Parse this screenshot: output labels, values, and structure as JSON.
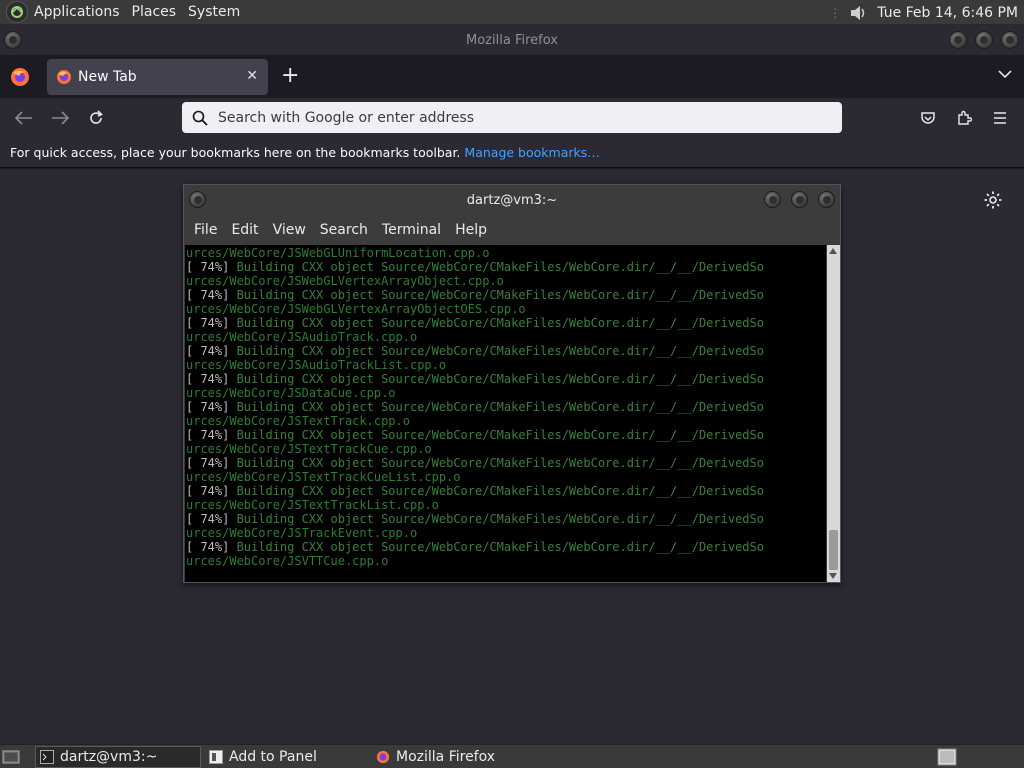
{
  "top_panel": {
    "menus": [
      "Applications",
      "Places",
      "System"
    ],
    "clock": "Tue Feb 14,  6:46 PM"
  },
  "firefox": {
    "window_title": "Mozilla Firefox",
    "tab": {
      "title": "New Tab",
      "close_glyph": "✕"
    },
    "new_tab_glyph": "+",
    "urlbar": {
      "placeholder": "Search with Google or enter address",
      "value": ""
    },
    "bookmarks_bar": {
      "message": "For quick access, place your bookmarks here on the bookmarks toolbar.",
      "link": "Manage bookmarks…"
    }
  },
  "terminal": {
    "title": "dartz@vm3:~",
    "menu": [
      "File",
      "Edit",
      "View",
      "Search",
      "Terminal",
      "Help"
    ],
    "lines": [
      {
        "t": "cont",
        "text": "urces/WebCore/JSWebGLUniformLocation.cpp.o"
      },
      {
        "t": "build",
        "pct": "[ 74%]",
        "text": " Building CXX object Source/WebCore/CMakeFiles/WebCore.dir/__/__/DerivedSo"
      },
      {
        "t": "cont",
        "text": "urces/WebCore/JSWebGLVertexArrayObject.cpp.o"
      },
      {
        "t": "build",
        "pct": "[ 74%]",
        "text": " Building CXX object Source/WebCore/CMakeFiles/WebCore.dir/__/__/DerivedSo"
      },
      {
        "t": "cont",
        "text": "urces/WebCore/JSWebGLVertexArrayObjectOES.cpp.o"
      },
      {
        "t": "build",
        "pct": "[ 74%]",
        "text": " Building CXX object Source/WebCore/CMakeFiles/WebCore.dir/__/__/DerivedSo"
      },
      {
        "t": "cont",
        "text": "urces/WebCore/JSAudioTrack.cpp.o"
      },
      {
        "t": "build",
        "pct": "[ 74%]",
        "text": " Building CXX object Source/WebCore/CMakeFiles/WebCore.dir/__/__/DerivedSo"
      },
      {
        "t": "cont",
        "text": "urces/WebCore/JSAudioTrackList.cpp.o"
      },
      {
        "t": "build",
        "pct": "[ 74%]",
        "text": " Building CXX object Source/WebCore/CMakeFiles/WebCore.dir/__/__/DerivedSo"
      },
      {
        "t": "cont",
        "text": "urces/WebCore/JSDataCue.cpp.o"
      },
      {
        "t": "build",
        "pct": "[ 74%]",
        "text": " Building CXX object Source/WebCore/CMakeFiles/WebCore.dir/__/__/DerivedSo"
      },
      {
        "t": "cont",
        "text": "urces/WebCore/JSTextTrack.cpp.o"
      },
      {
        "t": "build",
        "pct": "[ 74%]",
        "text": " Building CXX object Source/WebCore/CMakeFiles/WebCore.dir/__/__/DerivedSo"
      },
      {
        "t": "cont",
        "text": "urces/WebCore/JSTextTrackCue.cpp.o"
      },
      {
        "t": "build",
        "pct": "[ 74%]",
        "text": " Building CXX object Source/WebCore/CMakeFiles/WebCore.dir/__/__/DerivedSo"
      },
      {
        "t": "cont",
        "text": "urces/WebCore/JSTextTrackCueList.cpp.o"
      },
      {
        "t": "build",
        "pct": "[ 74%]",
        "text": " Building CXX object Source/WebCore/CMakeFiles/WebCore.dir/__/__/DerivedSo"
      },
      {
        "t": "cont",
        "text": "urces/WebCore/JSTextTrackList.cpp.o"
      },
      {
        "t": "build",
        "pct": "[ 74%]",
        "text": " Building CXX object Source/WebCore/CMakeFiles/WebCore.dir/__/__/DerivedSo"
      },
      {
        "t": "cont",
        "text": "urces/WebCore/JSTrackEvent.cpp.o"
      },
      {
        "t": "build",
        "pct": "[ 74%]",
        "text": " Building CXX object Source/WebCore/CMakeFiles/WebCore.dir/__/__/DerivedSo"
      },
      {
        "t": "cont",
        "text": "urces/WebCore/JSVTTCue.cpp.o"
      }
    ],
    "scroll_position": 0.95
  },
  "taskbar": {
    "items": [
      "dartz@vm3:~",
      "Add to Panel",
      "Mozilla Firefox"
    ]
  },
  "colors": {
    "firefox_bg": "#2b2a33",
    "link": "#45a1ff",
    "terminal_green": "#2e7d32"
  },
  "icons": [
    "gnome-foot-icon",
    "speaker-icon",
    "firefox-icon",
    "close-icon",
    "plus-icon",
    "chevron-down-icon",
    "back-icon",
    "forward-icon",
    "reload-icon",
    "search-icon",
    "pocket-icon",
    "extensions-icon",
    "menu-icon",
    "gear-icon",
    "terminal-icon",
    "panel-icon",
    "workspace-icon"
  ]
}
